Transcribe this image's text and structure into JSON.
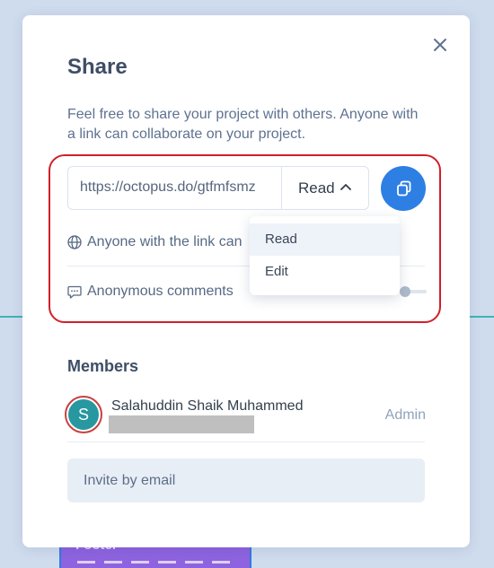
{
  "background": {
    "footer_card_label": "Footer"
  },
  "modal": {
    "title": "Share",
    "description": "Feel free to share your project with others. Anyone with a link can collaborate on your project.",
    "share_link": "https://octopus.do/gtfmfsmz",
    "permission": {
      "selected": "Read",
      "options": [
        "Read",
        "Edit"
      ]
    },
    "link_access_text": "Anyone with the link can",
    "anonymous_comments_label": "Anonymous comments",
    "anonymous_comments_enabled": false,
    "members_title": "Members",
    "members": [
      {
        "initial": "S",
        "name": "Salahuddin Shaik Muhammed",
        "role": "Admin"
      }
    ],
    "invite_placeholder": "Invite by email"
  },
  "colors": {
    "accent": "#2e7fe4",
    "highlight_border": "#d0202a",
    "avatar_bg": "#2797a0",
    "page_bg": "#cfdcee"
  },
  "icons": [
    "close-icon",
    "chevron-up-icon",
    "copy-icon",
    "globe-icon",
    "comment-icon"
  ]
}
